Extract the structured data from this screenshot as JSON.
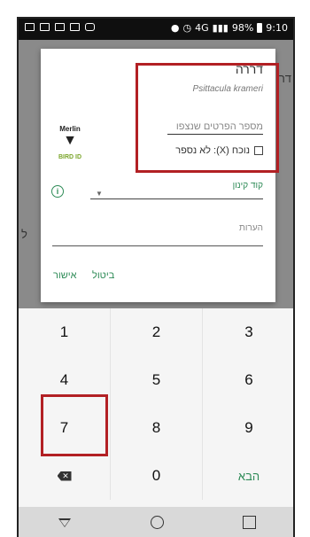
{
  "status_bar": {
    "signal": "▮▮▮",
    "network": "4G",
    "battery": "98%",
    "time": "9:10"
  },
  "background": {
    "left_fragment": "ל",
    "right_fragment": "דר"
  },
  "dialog": {
    "species_name": "דררה",
    "scientific_name": "Psittacula krameri",
    "count_placeholder": "מספר הפרטים שנצפו",
    "present_label": "נוכח (X): לא נספר",
    "nest_code_label": "קוד קינון",
    "notes_label": "הערות",
    "cancel_button": "ביטול",
    "ok_button": "אישור",
    "logo": {
      "word": "Merlin",
      "subtitle": "BIRD ID"
    }
  },
  "keypad": {
    "keys": [
      "1",
      "2",
      "3",
      "4",
      "5",
      "6",
      "7",
      "8",
      "9",
      "⌫",
      "0",
      "הבא"
    ]
  },
  "colors": {
    "accent": "#2e8b57",
    "highlight": "#b22024",
    "dim_overlay": "#8a8a8a"
  }
}
